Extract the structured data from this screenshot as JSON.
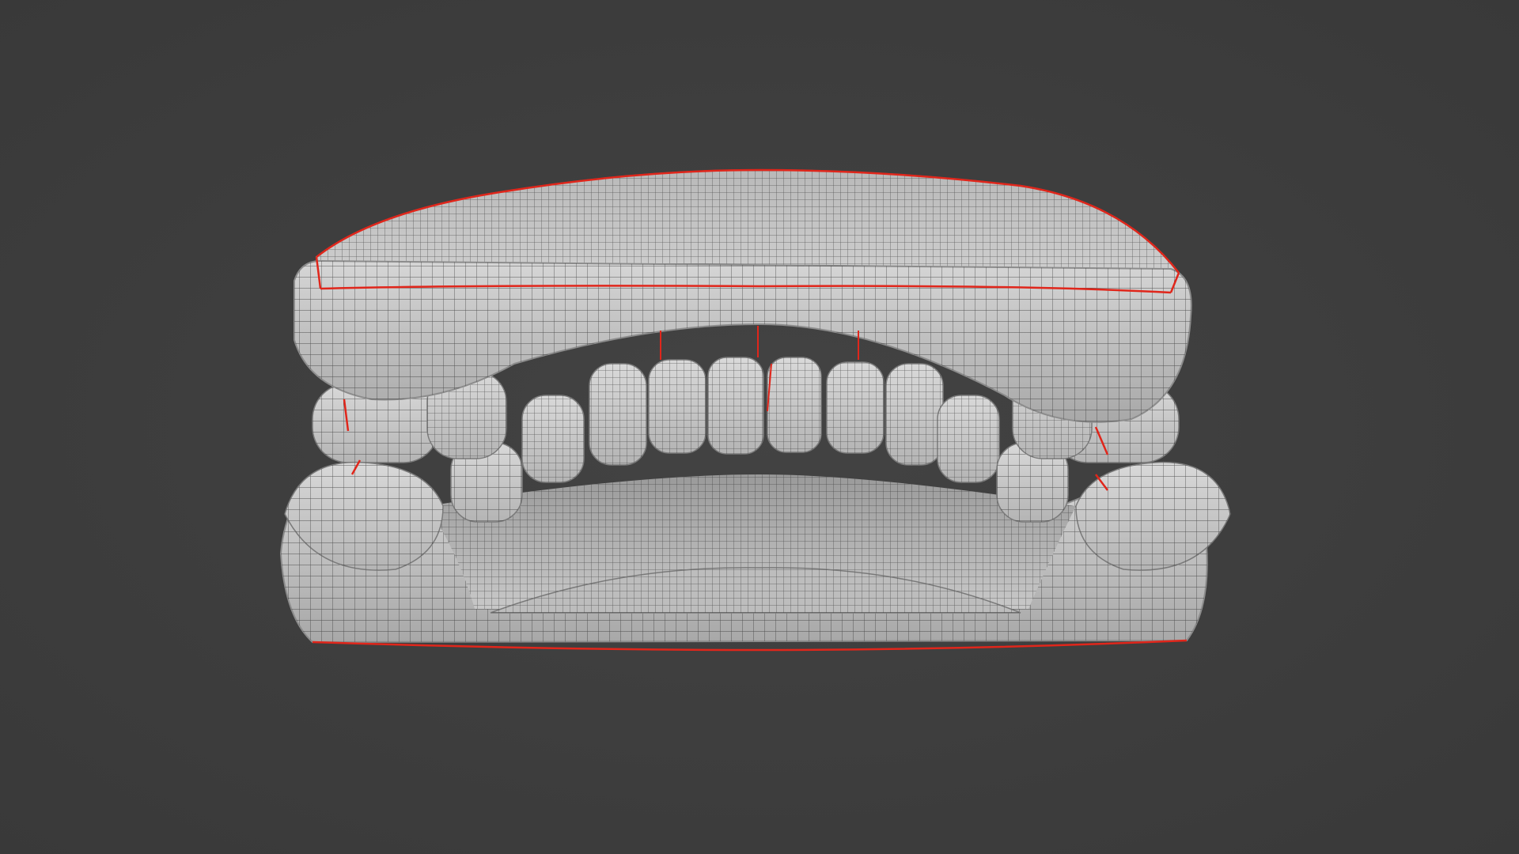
{
  "viewport": {
    "background_color": "#3d3d3d",
    "mesh_color": "#c4c4c4",
    "wire_color": "#2a2a2a",
    "seam_color": "#e0261b"
  },
  "model": {
    "icon": "dental-model-mesh",
    "shading": "solid-wireframe",
    "parts": [
      "upper-gum",
      "upper-teeth",
      "lower-teeth",
      "lower-gum",
      "tongue"
    ]
  }
}
